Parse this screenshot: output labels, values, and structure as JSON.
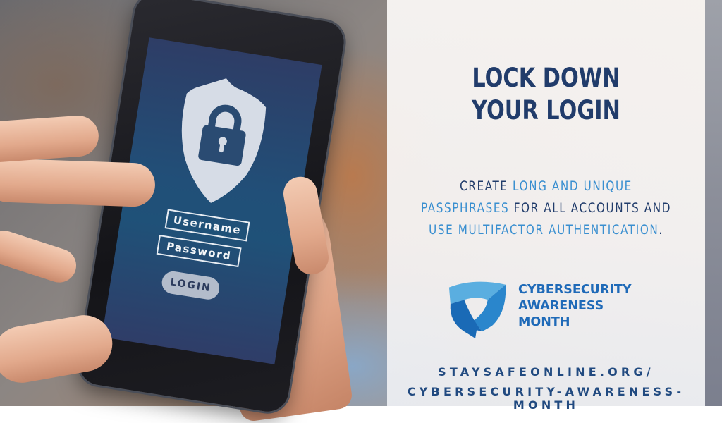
{
  "phone": {
    "screen": {
      "shield_icon": "shield-lock-icon",
      "username_label": "Username",
      "password_label": "Password",
      "login_label": "LOGIN"
    }
  },
  "panel": {
    "headline_line1": "LOCK DOWN",
    "headline_line2": "YOUR LOGIN",
    "body": {
      "line1_a": "CREATE ",
      "line1_b": "LONG AND UNIQUE",
      "line2_a": "PASSPHRASES",
      "line2_b": " FOR ALL ACCOUNTS AND",
      "line3_a": "USE MULTIFACTOR AUTHENTICATION",
      "line3_b": "."
    },
    "logo": {
      "icon": "cybersecurity-shield-logo",
      "line1": "CYBERSECURITY",
      "line2": "AWARENESS",
      "line3": "MONTH"
    },
    "url_line1": "STAYSAFEONLINE.ORG/",
    "url_line2": "CYBERSECURITY-AWARENESS-MONTH"
  },
  "colors": {
    "navy": "#213c6b",
    "accent_blue": "#3a8fd0",
    "logo_blue": "#1f6ab8",
    "screen_blue": "#214f78"
  }
}
